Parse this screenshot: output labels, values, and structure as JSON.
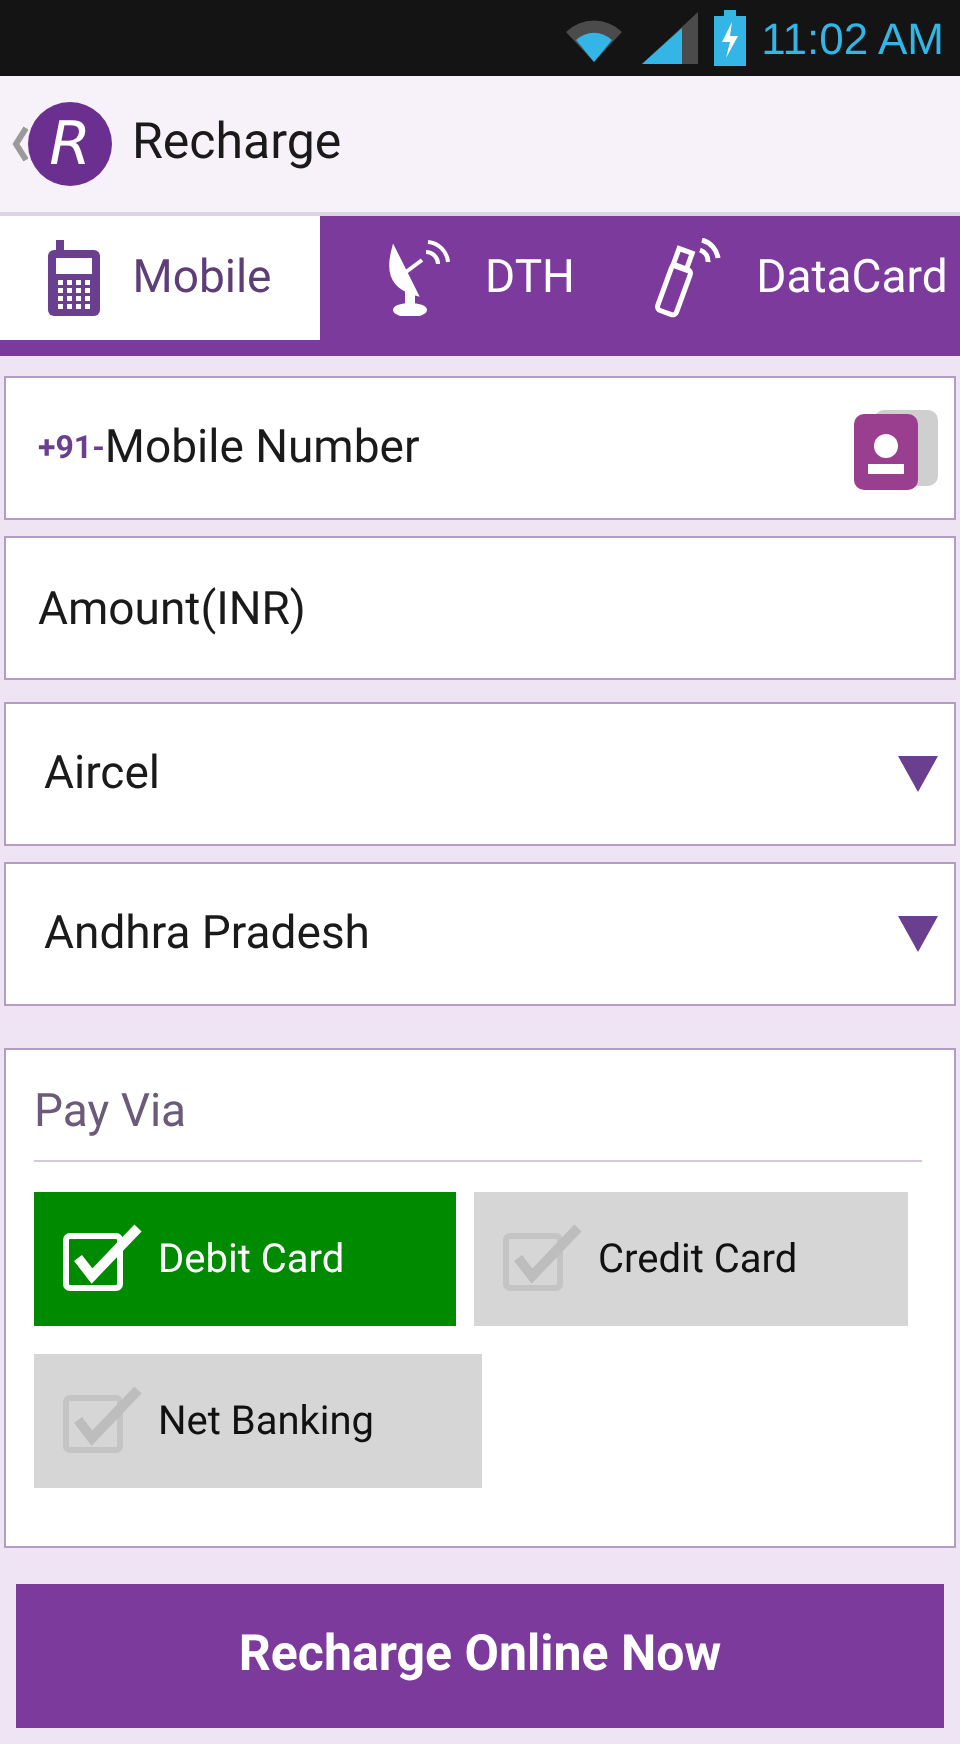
{
  "status_bar": {
    "time": "11:02 AM"
  },
  "app_bar": {
    "logo": "R",
    "title": "Recharge"
  },
  "tabs": [
    {
      "label": "Mobile",
      "kind": "mobile",
      "selected": true
    },
    {
      "label": "DTH",
      "kind": "dth",
      "selected": false
    },
    {
      "label": "DataCard",
      "kind": "datacard",
      "selected": false
    }
  ],
  "mobile_field": {
    "prefix": "+91-",
    "placeholder": "Mobile Number"
  },
  "amount_field": {
    "placeholder": "Amount(INR)"
  },
  "dropdowns": [
    {
      "value": "Aircel"
    },
    {
      "value": "Andhra Pradesh"
    }
  ],
  "pay_via": {
    "title": "Pay Via",
    "options": [
      {
        "label": "Debit Card",
        "selected": true
      },
      {
        "label": "Credit Card",
        "selected": false
      },
      {
        "label": "Net Banking",
        "selected": false
      }
    ]
  },
  "submit_button": "Recharge Online Now"
}
